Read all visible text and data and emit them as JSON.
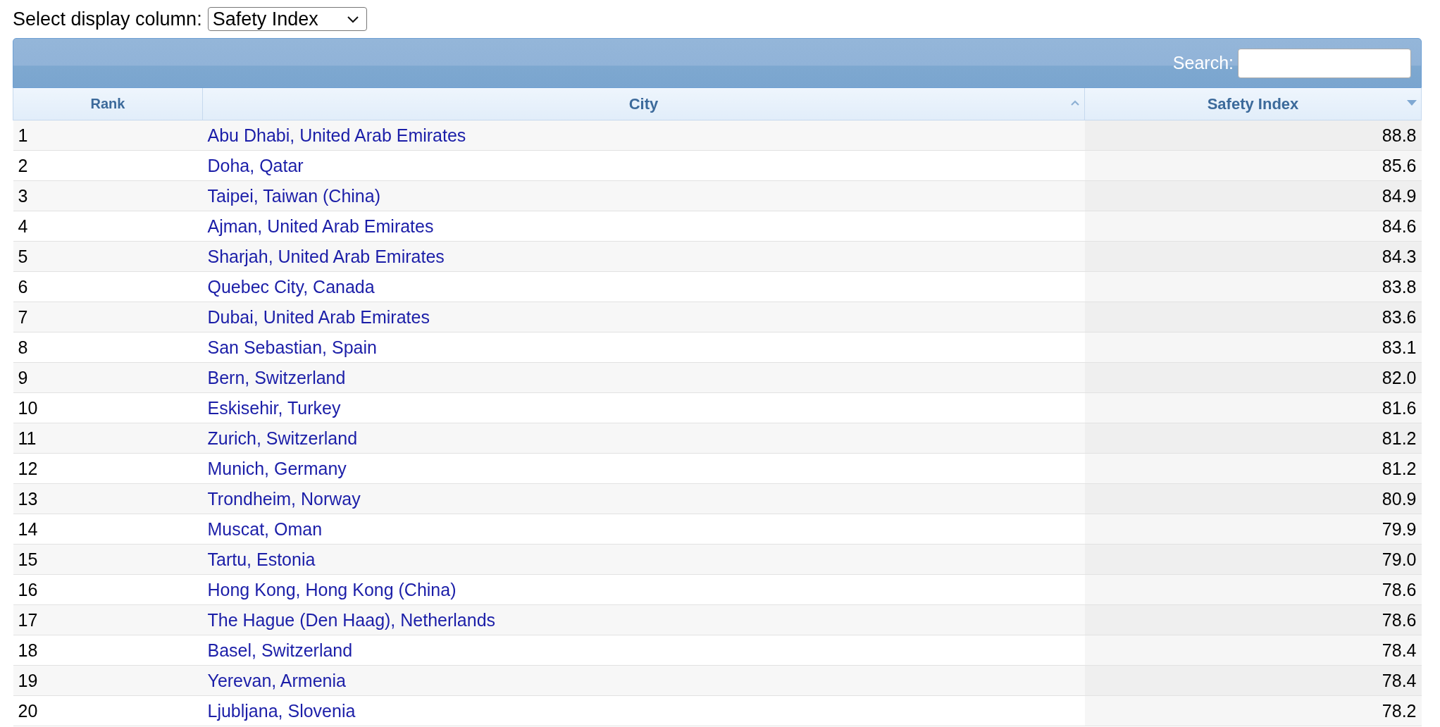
{
  "display_select": {
    "label": "Select display column:",
    "value": "Safety Index"
  },
  "search": {
    "label": "Search:"
  },
  "table": {
    "columns": [
      {
        "label": "Rank",
        "kind": "rank"
      },
      {
        "label": "City",
        "kind": "link",
        "sorted": false
      },
      {
        "label": "Safety Index",
        "kind": "number",
        "sorted": true
      }
    ],
    "rows": [
      [
        "1",
        "Abu Dhabi, United Arab Emirates",
        "88.8"
      ],
      [
        "2",
        "Doha, Qatar",
        "85.6"
      ],
      [
        "3",
        "Taipei, Taiwan (China)",
        "84.9"
      ],
      [
        "4",
        "Ajman, United Arab Emirates",
        "84.6"
      ],
      [
        "5",
        "Sharjah, United Arab Emirates",
        "84.3"
      ],
      [
        "6",
        "Quebec City, Canada",
        "83.8"
      ],
      [
        "7",
        "Dubai, United Arab Emirates",
        "83.6"
      ],
      [
        "8",
        "San Sebastian, Spain",
        "83.1"
      ],
      [
        "9",
        "Bern, Switzerland",
        "82.0"
      ],
      [
        "10",
        "Eskisehir, Turkey",
        "81.6"
      ],
      [
        "11",
        "Zurich, Switzerland",
        "81.2"
      ],
      [
        "12",
        "Munich, Germany",
        "81.2"
      ],
      [
        "13",
        "Trondheim, Norway",
        "80.9"
      ],
      [
        "14",
        "Muscat, Oman",
        "79.9"
      ],
      [
        "15",
        "Tartu, Estonia",
        "79.0"
      ],
      [
        "16",
        "Hong Kong, Hong Kong (China)",
        "78.6"
      ],
      [
        "17",
        "The Hague (Den Haag), Netherlands",
        "78.6"
      ],
      [
        "18",
        "Basel, Switzerland",
        "78.4"
      ],
      [
        "19",
        "Yerevan, Armenia",
        "78.4"
      ],
      [
        "20",
        "Ljubljana, Slovenia",
        "78.2"
      ]
    ]
  }
}
